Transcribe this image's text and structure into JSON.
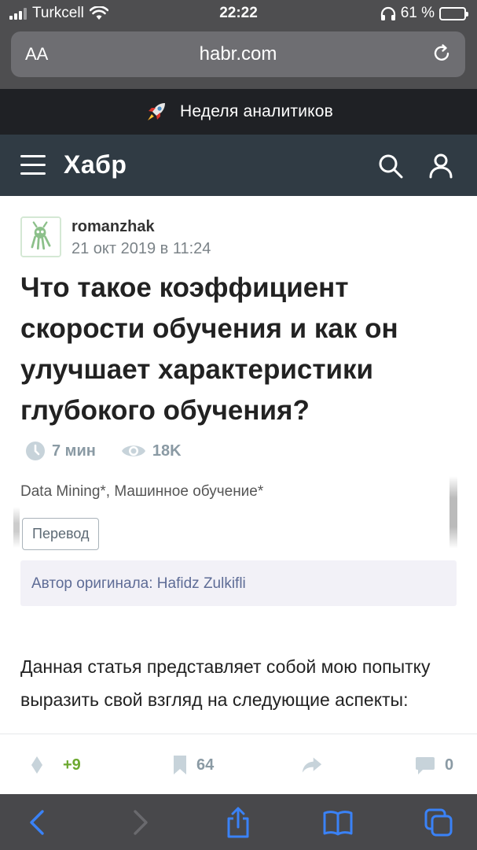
{
  "status_bar": {
    "carrier": "Turkcell",
    "time": "22:22",
    "battery": "61 %"
  },
  "browser": {
    "aa_label": "AA",
    "url": "habr.com"
  },
  "promo": {
    "text": "Неделя аналитиков"
  },
  "header": {
    "logo": "Хабр"
  },
  "article": {
    "author": "romanzhak",
    "date": "21 окт 2019 в 11:24",
    "title": "Что такое коэффициент скорости обучения и как он улучшает характеристики глубокого обучения?",
    "read_time": "7 мин",
    "views": "18K",
    "hubs": "Data Mining*, Машинное обучение*",
    "badge": "Перевод",
    "original_author": "Автор оригинала: Hafidz Zulkifli",
    "body": "Данная статья представляет собой мою попытку выразить свой взгляд на следующие аспекты:"
  },
  "actions": {
    "votes": "+9",
    "bookmarks": "64",
    "comments": "0"
  },
  "colors": {
    "header_bg": "#303b44",
    "vote_green": "#6ca82f",
    "toolbar_blue": "#3a82f7"
  }
}
